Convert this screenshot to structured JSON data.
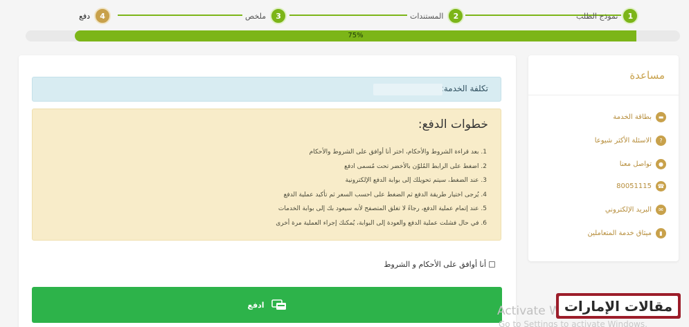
{
  "stepper": {
    "steps": [
      {
        "num": "1",
        "label": "نموذج الطلب"
      },
      {
        "num": "2",
        "label": "المستندات"
      },
      {
        "num": "3",
        "label": "ملخص"
      },
      {
        "num": "4",
        "label": "دفع"
      }
    ]
  },
  "progress": {
    "value": 0.75,
    "label": "75%"
  },
  "main": {
    "cost_label": "تكلفة الخدمة:",
    "steps_title": "خطوات الدفع:",
    "steps": [
      "1. بعد قراءة الشروط والأحكام، اختر أنا أوافق على الشروط والأحكام",
      "2. اضغط على الرابط المُلوّن بالأخضر تحت مُسمى ادفع",
      "3. عند الضغط، سيتم تحويلك إلى بوابة الدفع الإلكترونية",
      "4. يُرجى اختيار طريقة الدفع ثم الضغط على احسب السعر ثم تأكيد عملية الدفع",
      "5. عند إتمام عملية الدفع، رجاءً لا تغلق المتصفح لأنه سيعود بك إلى بوابة الخدمات",
      "6. في حال فشلت عملية الدفع والعودة إلى البوابة، يُمكنك إجراء العملية مرة أخرى"
    ],
    "agree_label": "أنا أوافق على الأحكام و الشروط",
    "pay_label": "ادفع"
  },
  "help": {
    "title": "مساعدة",
    "items": [
      {
        "label": "بطاقة الخدمة",
        "icon": "service-card-icon"
      },
      {
        "label": "الاسئلة الأكثر شيوعا",
        "icon": "question-icon"
      },
      {
        "label": "تواصل معنا",
        "icon": "location-pin-icon"
      },
      {
        "label": "80051115",
        "icon": "phone-icon"
      },
      {
        "label": "البريد الإلكتروني",
        "icon": "envelope-icon"
      },
      {
        "label": "ميثاق خدمة المتعاملين",
        "icon": "book-icon"
      }
    ]
  },
  "watermark": {
    "activate": "Activate W",
    "activate_sub": "Go to Settings to activate Windows.",
    "logo_text": "مقالات الإمارات"
  },
  "colors": {
    "green": "#7cb518",
    "gold": "#c8a14b",
    "pay_green": "#2db34a"
  }
}
